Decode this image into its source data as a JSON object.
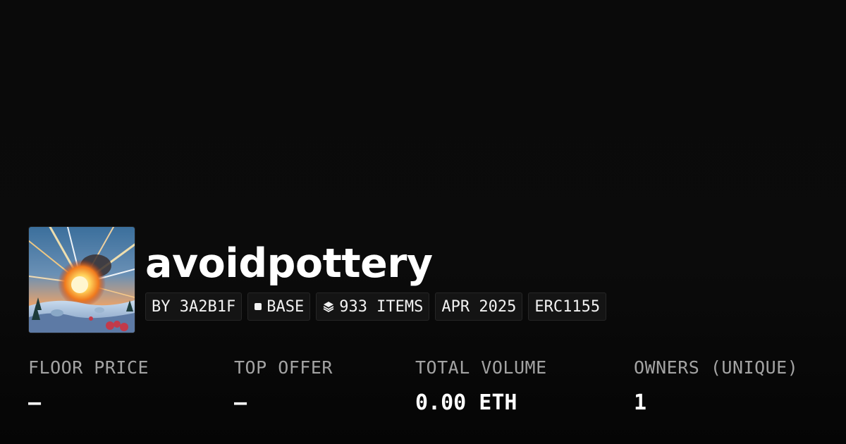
{
  "collection": {
    "name": "avoidpottery",
    "image_icon": "explosion-artwork-icon"
  },
  "tags": {
    "creator": "BY 3A2B1F",
    "chain": "BASE",
    "chain_icon": "square-icon",
    "items": "933 ITEMS",
    "items_icon": "layers-icon",
    "date": "APR 2025",
    "standard": "ERC1155"
  },
  "stats": {
    "floor_price": {
      "label": "FLOOR PRICE",
      "value": "–"
    },
    "top_offer": {
      "label": "TOP OFFER",
      "value": "–"
    },
    "total_volume": {
      "label": "TOTAL VOLUME",
      "value": "0.00 ETH"
    },
    "owners": {
      "label": "OWNERS (UNIQUE)",
      "value": "1"
    }
  },
  "colors": {
    "background": "#0a0a0a",
    "text": "#ffffff",
    "muted": "#a3a3a3",
    "tag_bg": "#141414",
    "tag_border": "#262626"
  }
}
